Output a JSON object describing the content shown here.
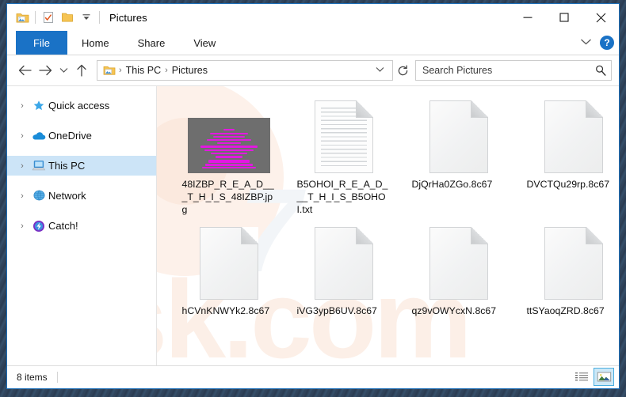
{
  "window": {
    "title": "Pictures",
    "quick_access": [
      {
        "name": "pictures-folder-icon",
        "label": "Pictures folder"
      },
      {
        "name": "properties-icon",
        "label": "Properties"
      },
      {
        "name": "new-folder-icon",
        "label": "New folder"
      },
      {
        "name": "customize-qat-icon",
        "label": "Customize Quick Access Toolbar"
      }
    ],
    "controls": {
      "minimize": "—",
      "maximize": "□",
      "close": "✕"
    }
  },
  "ribbon": {
    "tabs": [
      {
        "label": "File",
        "active": true
      },
      {
        "label": "Home",
        "active": false
      },
      {
        "label": "Share",
        "active": false
      },
      {
        "label": "View",
        "active": false
      }
    ],
    "expand_label": "⌄",
    "help_label": "?"
  },
  "address": {
    "back": "←",
    "forward": "→",
    "recent": "⌄",
    "up": "↑",
    "crumbs": [
      "This PC",
      "Pictures"
    ],
    "separator": "›",
    "dropdown": "⌄",
    "refresh": "↻"
  },
  "search": {
    "placeholder": "Search Pictures",
    "value": "",
    "icon": "search-icon"
  },
  "sidebar": {
    "items": [
      {
        "label": "Quick access",
        "icon": "star-icon",
        "selected": false
      },
      {
        "label": "OneDrive",
        "icon": "cloud-icon",
        "selected": false
      },
      {
        "label": "This PC",
        "icon": "computer-icon",
        "selected": true
      },
      {
        "label": "Network",
        "icon": "network-icon",
        "selected": false
      },
      {
        "label": "Catch!",
        "icon": "catch-icon",
        "selected": false
      }
    ],
    "chevron": "›"
  },
  "files": [
    {
      "name": "48IZBP_R_E_A_D___T_H_I_S_48IZBP.jpg",
      "type": "image"
    },
    {
      "name": "B5OHOI_R_E_A_D___T_H_I_S_B5OHOI.txt",
      "type": "text"
    },
    {
      "name": "DjQrHa0ZGo.8c67",
      "type": "blank"
    },
    {
      "name": "DVCTQu29rp.8c67",
      "type": "blank"
    },
    {
      "name": "hCVnKNWYk2.8c67",
      "type": "blank"
    },
    {
      "name": "iVG3ypB6UV.8c67",
      "type": "blank"
    },
    {
      "name": "qz9vOWYcxN.8c67",
      "type": "blank"
    },
    {
      "name": "ttSYaoqZRD.8c67",
      "type": "blank"
    }
  ],
  "watermark": {
    "top_text": "7",
    "bottom_text": "risk.com"
  },
  "statusbar": {
    "item_count": "8 items",
    "views": [
      {
        "name": "details-view-button",
        "active": false
      },
      {
        "name": "large-icons-view-button",
        "active": true
      }
    ]
  },
  "colors": {
    "accent": "#1a72c6",
    "selection": "#cce4f7",
    "window_border": "#1d6fb8",
    "ransom_text": "#e219e0",
    "thumb_bg": "#6e6e6e"
  }
}
